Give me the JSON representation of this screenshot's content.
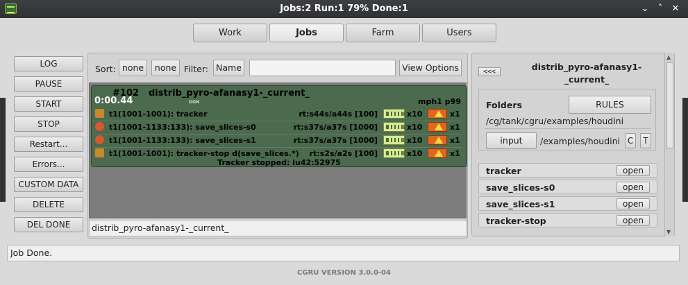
{
  "window": {
    "title": "Jobs:2 Run:1 79% Done:1",
    "minimize_glyph": "⌄",
    "restore_glyph": "˄",
    "close_glyph": "✕"
  },
  "tabs": [
    {
      "label": "Work",
      "active": false
    },
    {
      "label": "Jobs",
      "active": true
    },
    {
      "label": "Farm",
      "active": false
    },
    {
      "label": "Users",
      "active": false
    }
  ],
  "left_buttons": [
    "LOG",
    "PAUSE",
    "START",
    "STOP",
    "Restart...",
    "Errors...",
    "CUSTOM DATA",
    "DELETE",
    "DEL DONE"
  ],
  "toolbar": {
    "sort_label": "Sort:",
    "sort_1": "none",
    "sort_2": "none",
    "filter_label": "Filter:",
    "filter_field": "Name",
    "filter_value": "",
    "view_options": "View Options"
  },
  "job": {
    "id": "#102",
    "name": "distrib_pyro-afanasy1-_current_",
    "time": "0:00.44",
    "state": "DON",
    "host": "mph1 p99",
    "blocks": [
      {
        "icon": "tracker-icon",
        "name": "t1(1001-1001): tracker",
        "runtime": "rt:s44s/a44s [100]",
        "cap1": "x10",
        "cap2": "x1"
      },
      {
        "icon": "slices-icon",
        "name": "t1(1001-1133:133): save_slices-s0",
        "runtime": "rt:s37s/a37s [1000]",
        "cap1": "x10",
        "cap2": "x1"
      },
      {
        "icon": "slices-icon",
        "name": "t1(1001-1133:133): save_slices-s1",
        "runtime": "rt:s37s/a37s [1000]",
        "cap1": "x10",
        "cap2": "x1"
      },
      {
        "icon": "tracker-icon",
        "name": "t1(1001-1001): tracker-stop d(save_slices.*)",
        "runtime": "rt:s2s/a2s [100]",
        "cap1": "x10",
        "cap2": "x1"
      }
    ],
    "report": "Tracker stopped: lu42:52975",
    "colors": {
      "card": "#4b6a4e",
      "chip": "#d7e89a",
      "host_icon": "#e3661f"
    }
  },
  "job_name_field": "distrib_pyro-afanasy1-_current_",
  "right_panel": {
    "back": "<<<",
    "title": "distrib_pyro-afanasy1-_current_",
    "folders_label": "Folders",
    "rules_button": "RULES",
    "folder_path": "/cg/tank/cgru/examples/houdini",
    "input_button": "input",
    "input_path": "/examples/houdini",
    "c_button": "C",
    "t_button": "T",
    "blocks": [
      {
        "name": "tracker",
        "action": "open"
      },
      {
        "name": "save_slices-s0",
        "action": "open"
      },
      {
        "name": "save_slices-s1",
        "action": "open"
      },
      {
        "name": "tracker-stop",
        "action": "open"
      }
    ]
  },
  "status": "Job Done.",
  "version": "CGRU VERSION 3.0.0-04"
}
